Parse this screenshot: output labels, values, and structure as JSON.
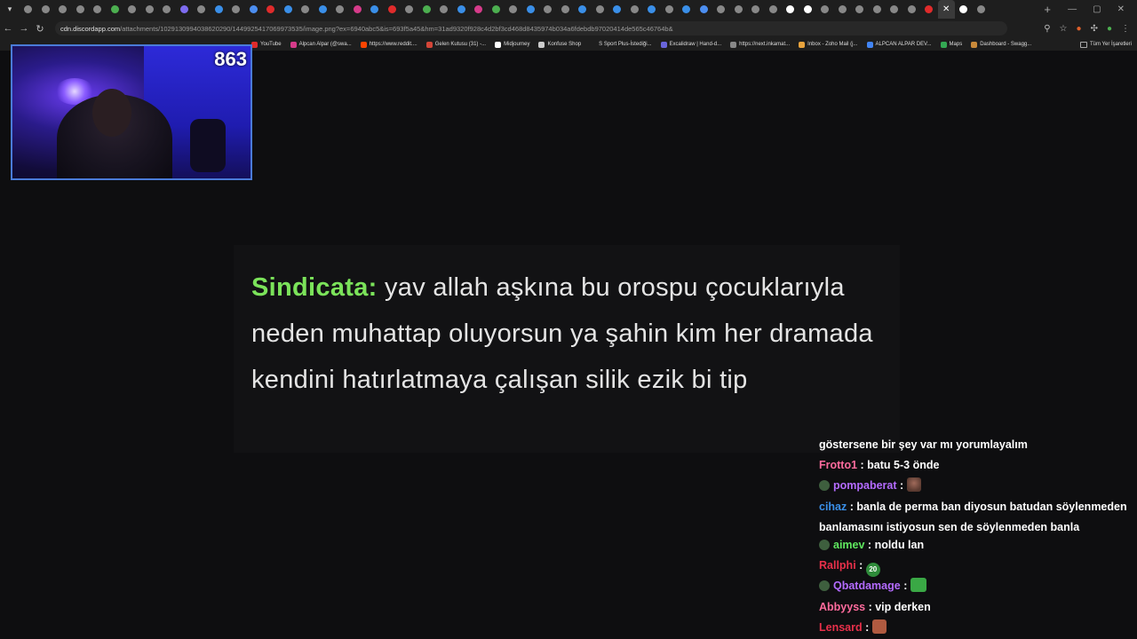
{
  "browser": {
    "url_host": "cdn.discordapp.com",
    "url_path": "/attachments/1029130994038620290/1449925417069973535/image.png?ex=6940abc5&is=693f5a45&hm=31ad9320f928c4d2bf3cd468d8435974b034a6fdebdb97020414de565c46764b&",
    "bookmarks": [
      {
        "label": "YouTube",
        "color": "#e02b2b"
      },
      {
        "label": "Alpcan Alpar (@swa...",
        "color": "#d63b8a"
      },
      {
        "label": "https://www.reddit....",
        "color": "#ff4500"
      },
      {
        "label": "Gelen Kutusu (31) -...",
        "color": "#d44638"
      },
      {
        "label": "Midjourney",
        "color": "#ffffff"
      },
      {
        "label": "Konfuse Shop",
        "color": "#cccccc"
      },
      {
        "label": "S Sport Plus-İstediği...",
        "color": "#1e1e1e"
      },
      {
        "label": "Excalidraw | Hand-d...",
        "color": "#6965db"
      },
      {
        "label": "https://next.inkamat...",
        "color": "#888888"
      },
      {
        "label": "Inbox - Zoho Mail (j...",
        "color": "#e8a33d"
      },
      {
        "label": "ALPCAN ALPAR DEV...",
        "color": "#4285f4"
      },
      {
        "label": "Maps",
        "color": "#34a853"
      },
      {
        "label": "Dashboard - Swagg...",
        "color": "#c98a3a"
      }
    ],
    "bookmarks_all": "Tüm Yer İşaretleri"
  },
  "webcam": {
    "viewer_count": "863"
  },
  "quote": {
    "author": "Sindicata",
    "separator": ":",
    "text": " yav allah aşkına bu orospu çocuklarıyla neden muhattap oluyorsun ya şahin kim her dramada kendini hatırlatmaya çalışan silik ezik bi tip"
  },
  "chat": {
    "messages": [
      {
        "user": "",
        "text": "göstersene bir şey var mı yorumlayalım",
        "color": "#ffffff"
      },
      {
        "user": "Frotto1",
        "text": "batu 5-3 önde",
        "color": "#ff6b9d"
      },
      {
        "user": "pompaberat",
        "text": "",
        "color": "#b46bff",
        "badge": true,
        "emote": "face"
      },
      {
        "user": "cihaz",
        "text": "banla de perma ban diyosun batudan söylenmeden banlamasını istiyosun sen de söylenmeden banla",
        "color": "#3a8fe8"
      },
      {
        "user": "aimev",
        "text": "noldu lan",
        "color": "#5fe85f",
        "badge": true
      },
      {
        "user": "Rallphi",
        "text": "",
        "color": "#e8304a",
        "emote": "twenty"
      },
      {
        "user": "Qbatdamage",
        "text": "",
        "color": "#b46bff",
        "badge": true,
        "emote": "green"
      },
      {
        "user": "Abbyyss",
        "text": "vip derken",
        "color": "#ff6b9d"
      },
      {
        "user": "Lensard",
        "text": "",
        "color": "#e8304a",
        "emote": "block"
      }
    ],
    "emote_20_label": "20"
  }
}
